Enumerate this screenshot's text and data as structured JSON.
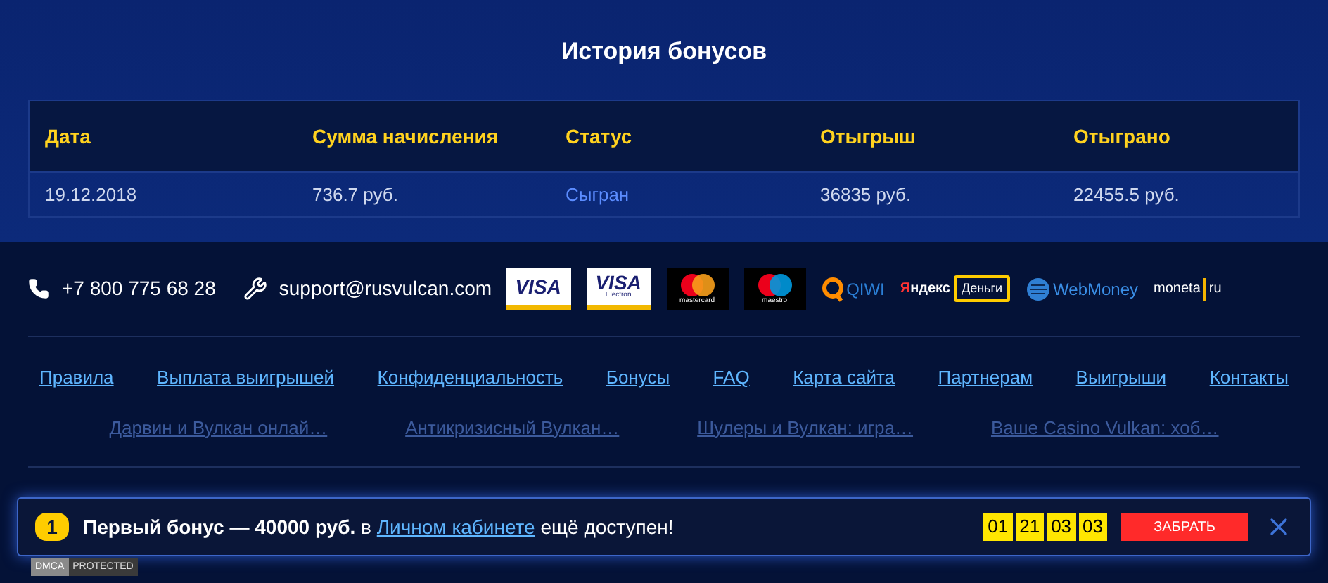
{
  "title": "История бонусов",
  "table": {
    "columns": [
      "Дата",
      "Сумма начисления",
      "Статус",
      "Отыгрыш",
      "Отыграно"
    ],
    "rows": [
      {
        "cells": [
          "19.12.2018",
          "736.7 руб.",
          "Сыгран",
          "36835 руб.",
          "22455.5 руб."
        ]
      }
    ]
  },
  "contacts": {
    "phone": "+7 800 775 68 28",
    "email": "support@rusvulcan.com"
  },
  "payments": [
    {
      "kind": "visa",
      "label": "VISA"
    },
    {
      "kind": "visa-electron",
      "label": "VISA",
      "sub": "Electron"
    },
    {
      "kind": "mastercard",
      "label": "mastercard"
    },
    {
      "kind": "maestro",
      "label": "maestro"
    },
    {
      "kind": "qiwi",
      "label": "QIWI"
    },
    {
      "kind": "yandex",
      "label": "Яндекс",
      "sub": "Деньги"
    },
    {
      "kind": "webmoney",
      "label": "WebMoney"
    },
    {
      "kind": "moneta",
      "label": "moneta",
      "sub": "ru"
    }
  ],
  "links": [
    "Правила",
    "Выплата выигрышей",
    "Конфиденциальность",
    "Бонусы",
    "FAQ",
    "Карта сайта",
    "Партнерам",
    "Выигрыши",
    "Контакты"
  ],
  "articles": [
    "Дарвин и Вулкан онлай…",
    "Антикризисный Вулкан…",
    "Шулеры и Вулкан: игра…",
    "Ваше Casino Vulkan: хоб…"
  ],
  "banner": {
    "badge": "1",
    "text_bold": "Первый бонус — 40000 руб.",
    "text_before": "в",
    "link": "Личном кабинете",
    "text_after": "ещё доступен!",
    "timer": [
      "01",
      "21",
      "03",
      "03"
    ],
    "button": "ЗАБРАТЬ"
  },
  "dmca": {
    "left": "DMCA",
    "right": "PROTECTED"
  }
}
